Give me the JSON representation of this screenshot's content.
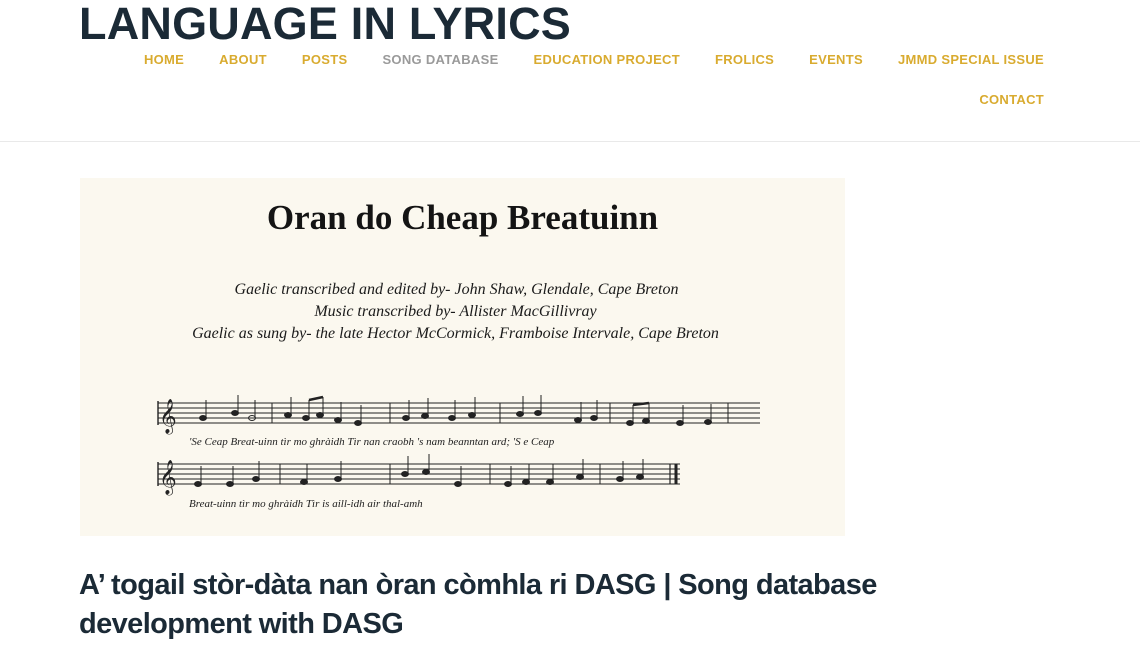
{
  "site": {
    "title": "LANGUAGE IN LYRICS"
  },
  "nav": {
    "row1": [
      "HOME",
      "ABOUT",
      "POSTS",
      "SONG DATABASE",
      "EDUCATION PROJECT",
      "FROLICS",
      "EVENTS",
      "JMMD SPECIAL ISSUE"
    ],
    "row2": [
      "CONTACT"
    ],
    "current": "SONG DATABASE"
  },
  "featured_image": {
    "score_title": "Oran do Cheap Breatuinn",
    "credits": [
      "Gaelic transcribed and edited by-  John Shaw,  Glendale,  Cape Breton",
      "Music transcribed by-  Allister MacGillivray",
      "Gaelic as sung by-  the late Hector McCormick,  Framboise Intervale,  Cape Breton"
    ],
    "lyrics": [
      "'Se Ceap Breat-uinn tìr mo ghràidh Tìr nan craobh 's nam beanntan ard; 'S e Ceap",
      "Breat-uinn tìr mo ghràidh Tìr is  aill-idh air thal-amh"
    ]
  },
  "post": {
    "title": "A’ togail stòr-dàta nan òran còmhla ri DASG | Song database development with DASG"
  }
}
